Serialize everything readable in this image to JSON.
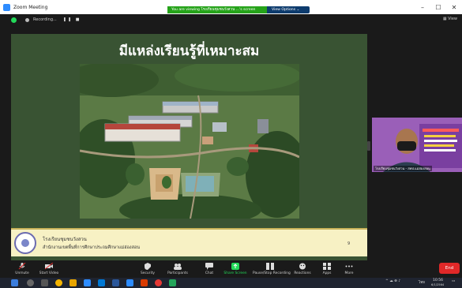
{
  "window": {
    "title": "Zoom Meeting",
    "minimize": "–",
    "maximize": "☐",
    "close": "✕"
  },
  "banner": {
    "text": "You are viewing โรงเรียนชุมชนวังสวน ...'s screen",
    "view_options": "View Options ⌄"
  },
  "topbar": {
    "recording": "Recording...",
    "controls": "❚❚ ■",
    "view": "▦ View"
  },
  "slide": {
    "title": "มีแหล่งเรียนรู้ที่เหมาะสม",
    "school": "โรงเรียนชุมชนวังสวน",
    "office": "สำนักงานเขตพื้นที่การศึกษาประถมศึกษาแม่ฮ่องสอน",
    "page": "9"
  },
  "camera": {
    "name": "โรงเรียนชุมชนวังสวน - สพป.แม่ฮ่องสอน"
  },
  "toolbar": {
    "items": [
      {
        "label": "Unmute",
        "icon": "microphone-icon"
      },
      {
        "label": "Start Video",
        "icon": "video-camera-icon"
      },
      {
        "label": "Security",
        "icon": "shield-icon"
      },
      {
        "label": "Participants",
        "icon": "participants-icon",
        "count": "87"
      },
      {
        "label": "Chat",
        "icon": "chat-icon"
      },
      {
        "label": "Share Screen",
        "icon": "share-screen-icon"
      },
      {
        "label": "Pause/Stop Recording",
        "icon": "recording-icon"
      },
      {
        "label": "Reactions",
        "icon": "reactions-icon"
      },
      {
        "label": "Apps",
        "icon": "apps-icon"
      },
      {
        "label": "More",
        "icon": "more-icon"
      }
    ],
    "end": "End"
  },
  "taskbar": {
    "time": "10:56",
    "date": "6/1/2564",
    "lang": "ไทย"
  },
  "colors": {
    "slide_bg": "#395333",
    "banner_green": "#26a31a",
    "end_red": "#e02828"
  }
}
